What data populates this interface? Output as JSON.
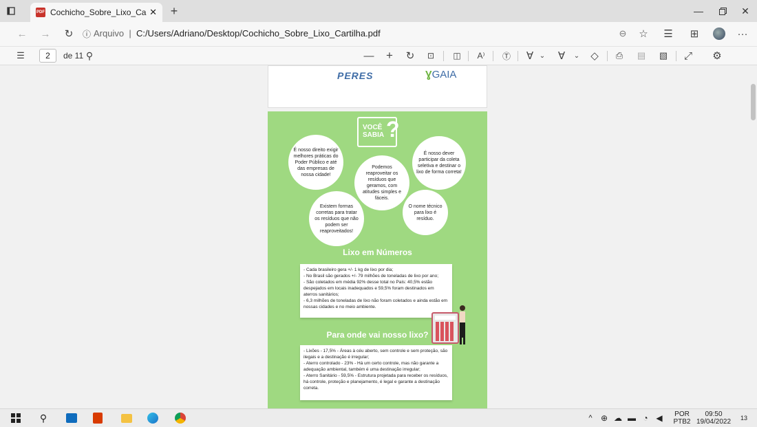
{
  "browser": {
    "tab_title": "Cochicho_Sobre_Lixo_Cartilha.pd",
    "tab_close": "✕",
    "new_tab": "+",
    "url_prefix": "Arquivo",
    "url": "C:/Users/Adriano/Desktop/Cochicho_Sobre_Lixo_Cartilha.pdf"
  },
  "pdf_toolbar": {
    "page_number": "2",
    "page_total": "de 11"
  },
  "page1": {
    "logo_left": "PERES",
    "logo_right": "GAIA"
  },
  "page2": {
    "badge_line1": "VOCÊ",
    "badge_line2": "SABIA",
    "bubbles": [
      "É nosso direito exigir melhores práticas do Poder Público e até das empresas de nossa cidade!",
      "Podemos reaproveitar os resíduos que geramos, com atitudes simples e fáceis.",
      "É nosso dever participar da coleta seletiva e destinar o lixo de forma correta!",
      "Existem formas corretas para tratar os resíduos que não podem ser reaproveitados!",
      "O nome técnico para lixo é resíduo."
    ],
    "section1_title": "Lixo em Números",
    "section1_lines": [
      "- Cada brasileiro gera +/- 1 kg de lixo por dia;",
      "- No Brasil são gerados +/- 79 milhões de toneladas de lixo por ano;",
      "- São coletados em média 92% desse total no País: 40,5% estão despejados em locais inadequados e 59,5% foram destinados em aterros sanitários;",
      "- 6,3 milhões de toneladas de lixo não foram coletados e ainda estão em nossas cidades e no meio ambiente."
    ],
    "section2_title": "Para onde vai nosso lixo?",
    "section2_lines": [
      "- Lixões - 17,5% - Áreas à céu aberto, sem controle e sem proteção, são ilegais e a destinação é irregular;",
      "- Aterro controlado - 23% - Há um certo controle, mas não garante a adequação ambiental, também é uma destinação irregular;",
      "- Aterro Sanitário - 59,5% - Estrutura projetada para receber os resíduos, há controle, proteção e planejamento, é legal e garante a destinação correta."
    ]
  },
  "taskbar": {
    "lang1": "POR",
    "lang2": "PTB2",
    "time": "09:50",
    "date": "19/04/2022",
    "notif": "13"
  },
  "colors": {
    "page_green": "#9fd981",
    "pdf_red": "#c8332b",
    "logo_blue": "#3e6ca6"
  }
}
